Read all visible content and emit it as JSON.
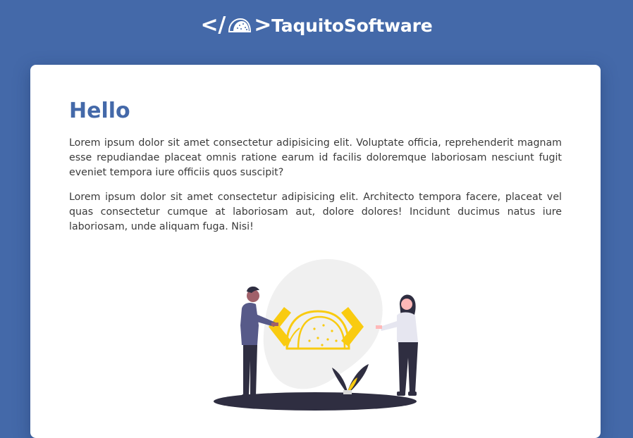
{
  "header": {
    "brand_open": "</",
    "brand_close": ">",
    "brand_name": "TaquitoSoftware",
    "logo_icon": "taco-icon"
  },
  "main": {
    "title": "Hello",
    "paragraphs": [
      "Lorem ipsum dolor sit amet consectetur adipisicing elit. Voluptate officia, reprehenderit magnam esse repudiandae placeat omnis ratione earum id facilis doloremque laboriosam nesciunt fugit eveniet tempora iure officiis quos suscipit?",
      "Lorem ipsum dolor sit amet consectetur adipisicing elit. Architecto tempora facere, placeat vel quas consectetur cumque at laboriosam aut, dolore dolores! Incidunt ducimus natus iure laboriosam, unde aliquam fuga. Nisi!"
    ],
    "illustration_icon": "people-holding-taco-code-illustration"
  },
  "colors": {
    "background": "#4469a9",
    "title": "#4469a9",
    "accent_yellow": "#f9cb10",
    "text": "#3a3a3a"
  }
}
